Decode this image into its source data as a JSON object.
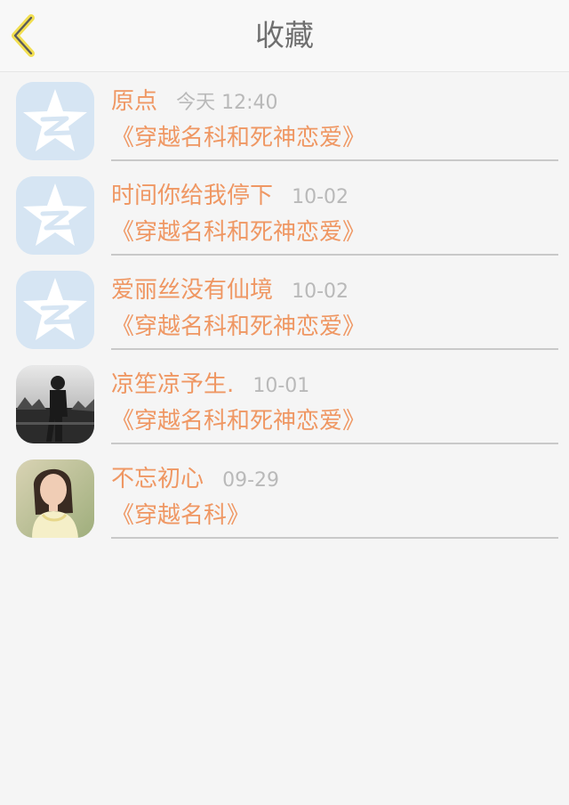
{
  "header": {
    "title": "收藏"
  },
  "items": [
    {
      "name": "原点",
      "time": "今天 12:40",
      "book": "《穿越名科和死神恋爱》",
      "avatar": "qzone-default-avatar"
    },
    {
      "name": "时间你给我停下",
      "time": "10-02",
      "book": "《穿越名科和死神恋爱》",
      "avatar": "qzone-default-avatar"
    },
    {
      "name": "爱丽丝没有仙境",
      "time": "10-02",
      "book": "《穿越名科和死神恋爱》",
      "avatar": "qzone-default-avatar"
    },
    {
      "name": "凉笙凉予生.",
      "time": "10-01",
      "book": "《穿越名科和死神恋爱》",
      "avatar": "photo-avatar-man"
    },
    {
      "name": "不忘初心",
      "time": "09-29",
      "book": "《穿越名科》",
      "avatar": "photo-avatar-woman"
    }
  ],
  "colors": {
    "accent": "#ef9763",
    "back_icon": "#f2df50"
  }
}
